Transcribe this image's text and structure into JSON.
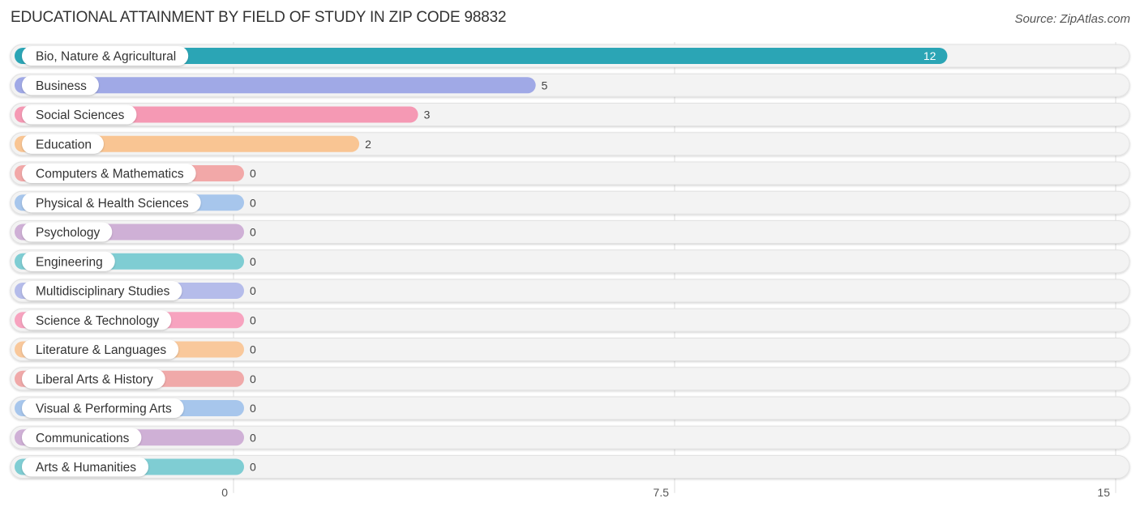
{
  "header": {
    "title": "EDUCATIONAL ATTAINMENT BY FIELD OF STUDY IN ZIP CODE 98832",
    "source": "Source: ZipAtlas.com"
  },
  "chart_data": {
    "type": "bar",
    "orientation": "horizontal",
    "title": "EDUCATIONAL ATTAINMENT BY FIELD OF STUDY IN ZIP CODE 98832",
    "xlabel": "",
    "ylabel": "",
    "xlim": [
      0,
      15
    ],
    "ticks": [
      0,
      7.5,
      15
    ],
    "tick_labels": [
      "0",
      "7.5",
      "15"
    ],
    "grid": true,
    "categories": [
      "Bio, Nature & Agricultural",
      "Business",
      "Social Sciences",
      "Education",
      "Computers & Mathematics",
      "Physical & Health Sciences",
      "Psychology",
      "Engineering",
      "Multidisciplinary Studies",
      "Science & Technology",
      "Literature & Languages",
      "Liberal Arts & History",
      "Visual & Performing Arts",
      "Communications",
      "Arts & Humanities"
    ],
    "values": [
      12,
      5,
      3,
      2,
      0,
      0,
      0,
      0,
      0,
      0,
      0,
      0,
      0,
      0,
      0
    ],
    "value_labels": [
      "12",
      "5",
      "3",
      "2",
      "0",
      "0",
      "0",
      "0",
      "0",
      "0",
      "0",
      "0",
      "0",
      "0",
      "0"
    ],
    "colors": [
      "#2ba5b5",
      "#a0a9e6",
      "#f599b4",
      "#f9c593",
      "#f2a8a8",
      "#a7c6ec",
      "#cfb0d6",
      "#7fcdd3",
      "#b5bcea",
      "#f7a3bf",
      "#f9c89b",
      "#f0a9a9",
      "#a7c6ec",
      "#cfb0d6",
      "#7fcdd3"
    ]
  }
}
